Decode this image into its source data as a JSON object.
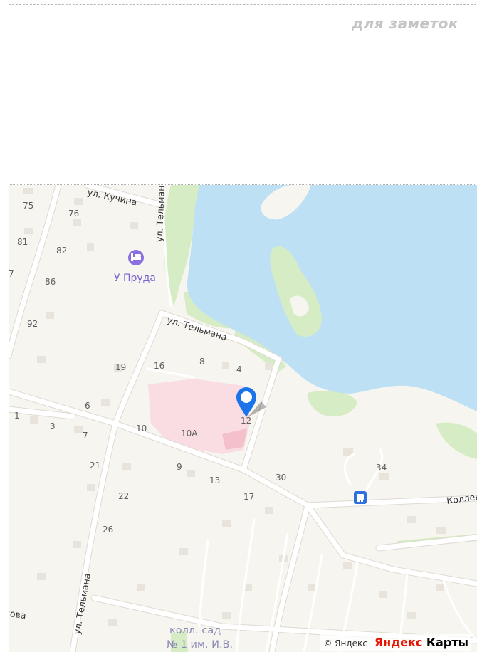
{
  "notes": {
    "label": "для заметок"
  },
  "map": {
    "streets": {
      "kuchina": "ул. Кучина",
      "telmana_top": "ул. Тельмана",
      "telmana_mid": "ул. Тельмана",
      "telmana_bottom": "ул. Тельмана",
      "kollek": "Коллек",
      "kova": "кова"
    },
    "poi": {
      "hotel": "У Пруда"
    },
    "garden": {
      "line1": "колл. сад",
      "line2": "№ 1 им. И.В."
    },
    "houses": {
      "h75": "75",
      "h76": "76",
      "h81": "81",
      "h82": "82",
      "h7a": "7",
      "h86": "86",
      "h92": "92",
      "h19": "19",
      "h16": "16",
      "h8": "8",
      "h4": "4",
      "h6": "6",
      "h12": "12",
      "h1": "1",
      "h3": "3",
      "h7b": "7",
      "h10": "10",
      "h10a": "10А",
      "h21": "21",
      "h9": "9",
      "h13": "13",
      "h30": "30",
      "h34": "34",
      "h17": "17",
      "h22": "22",
      "h26": "26"
    },
    "icons": {
      "pin": "map-pin-icon",
      "hotel": "bed-icon",
      "bus": "bus-stop-icon"
    }
  },
  "attribution": {
    "copyright": "© Яндекс",
    "brand_first": "Яндекс",
    "brand_second": " Карты"
  },
  "colors": {
    "water": "#bde0f5",
    "park": "#d5ecc4",
    "hospital": "#f9dde3",
    "land": "#f7f5ef",
    "road": "#ffffff",
    "pin": "#1a73e8"
  }
}
